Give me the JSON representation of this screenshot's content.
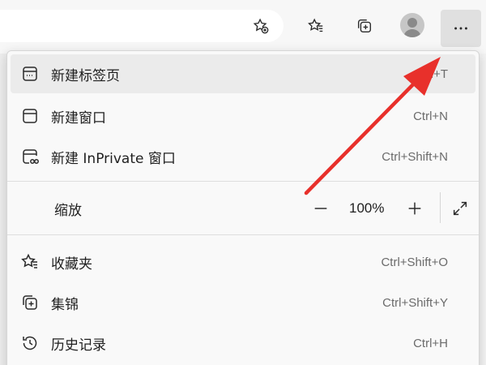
{
  "toolbar": {
    "icons": [
      "favorite-add-icon",
      "favorites-icon",
      "collections-icon",
      "profile-avatar",
      "more-icon"
    ]
  },
  "menu": {
    "items": [
      {
        "label": "新建标签页",
        "shortcut": "Ctrl+T",
        "icon": "new-tab-icon"
      },
      {
        "label": "新建窗口",
        "shortcut": "Ctrl+N",
        "icon": "new-window-icon"
      },
      {
        "label": "新建 InPrivate 窗口",
        "shortcut": "Ctrl+Shift+N",
        "icon": "inprivate-window-icon"
      },
      {
        "label": "收藏夹",
        "shortcut": "Ctrl+Shift+O",
        "icon": "favorites-icon"
      },
      {
        "label": "集锦",
        "shortcut": "Ctrl+Shift+Y",
        "icon": "collections-icon"
      },
      {
        "label": "历史记录",
        "shortcut": "Ctrl+H",
        "icon": "history-icon"
      }
    ],
    "zoom": {
      "label": "缩放",
      "value": "100%",
      "minus": "−",
      "plus": "+"
    }
  },
  "colors": {
    "annotation_arrow": "#e8302b",
    "menu_background": "#f9f9f9",
    "hover_background": "#ebebeb"
  }
}
